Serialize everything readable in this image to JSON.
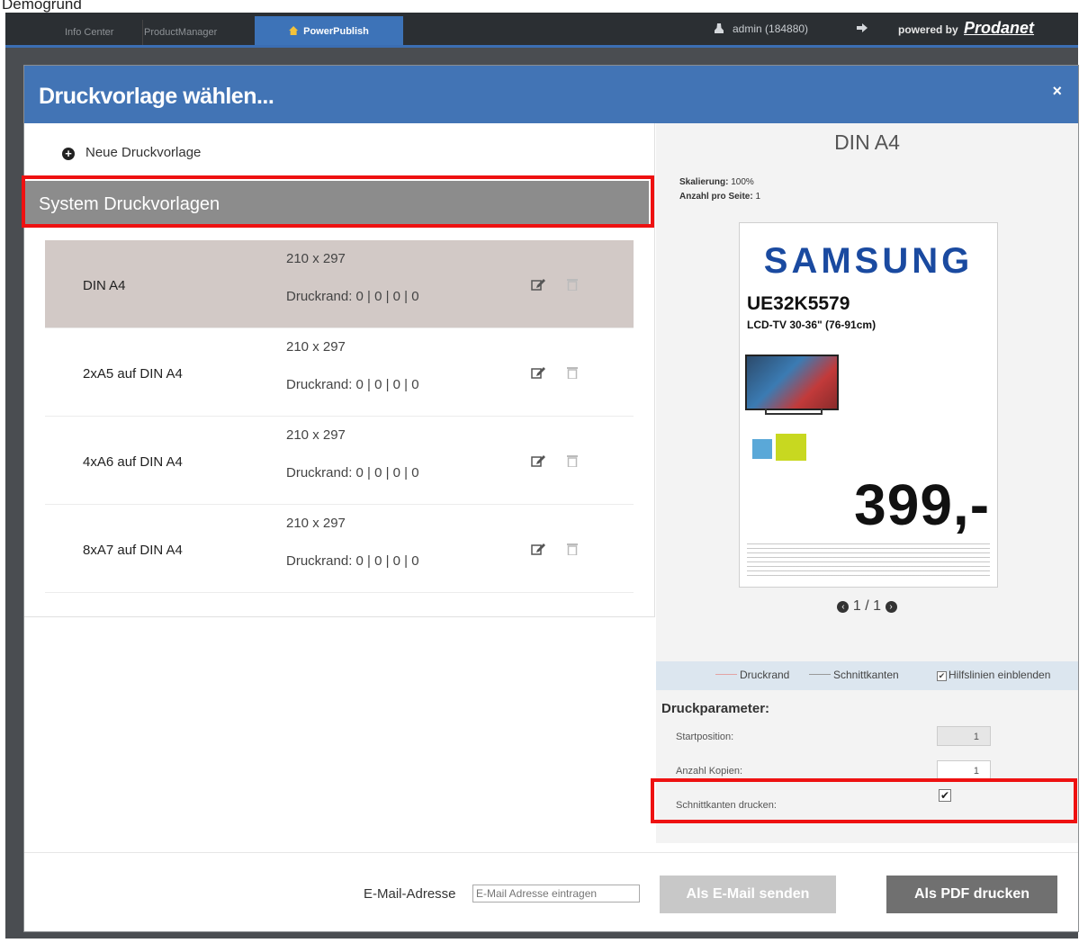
{
  "top_label": "Demogrund",
  "app_bar": {
    "tabs": [
      "Info Center",
      "ProductManager",
      "PowerPublish"
    ],
    "user": "admin (184880)",
    "powered_by": "powered by",
    "brand": "Prodanet"
  },
  "modal": {
    "title": "Druckvorlage wählen...",
    "close": "×",
    "new_template": "Neue Druckvorlage",
    "system_header": "System Druckvorlagen",
    "templates": [
      {
        "name": "DIN A4",
        "size": "210 x 297",
        "margin": "Druckrand: 0 | 0 | 0 | 0"
      },
      {
        "name": "2xA5 auf DIN A4",
        "size": "210 x 297",
        "margin": "Druckrand: 0 | 0 | 0 | 0"
      },
      {
        "name": "4xA6 auf DIN A4",
        "size": "210 x 297",
        "margin": "Druckrand: 0 | 0 | 0 | 0"
      },
      {
        "name": "8xA7 auf DIN A4",
        "size": "210 x 297",
        "margin": "Druckrand: 0 | 0 | 0 | 0"
      }
    ],
    "preview": {
      "title": "DIN A4",
      "scale_label": "Skalierung:",
      "scale_value": "100%",
      "per_page_label": "Anzahl pro Seite:",
      "per_page_value": "1",
      "card": {
        "brand": "SAMSUNG",
        "model": "UE32K5579",
        "subtitle": "LCD-TV 30-36\" (76-91cm)",
        "price": "399,-"
      },
      "pager": "1 / 1"
    },
    "legend": {
      "margin": "Druckrand",
      "cut": "Schnittkanten",
      "guides": "Hilfslinien einblenden"
    },
    "params": {
      "title": "Druckparameter:",
      "start_label": "Startposition:",
      "start_value": "1",
      "copies_label": "Anzahl Kopien:",
      "copies_value": "1",
      "cut_label": "Schnittkanten drucken:"
    },
    "footer": {
      "email_label": "E-Mail-Adresse",
      "email_placeholder": "E-Mail Adresse eintragen",
      "send_button": "Als E-Mail senden",
      "pdf_button": "Als PDF drucken"
    }
  }
}
